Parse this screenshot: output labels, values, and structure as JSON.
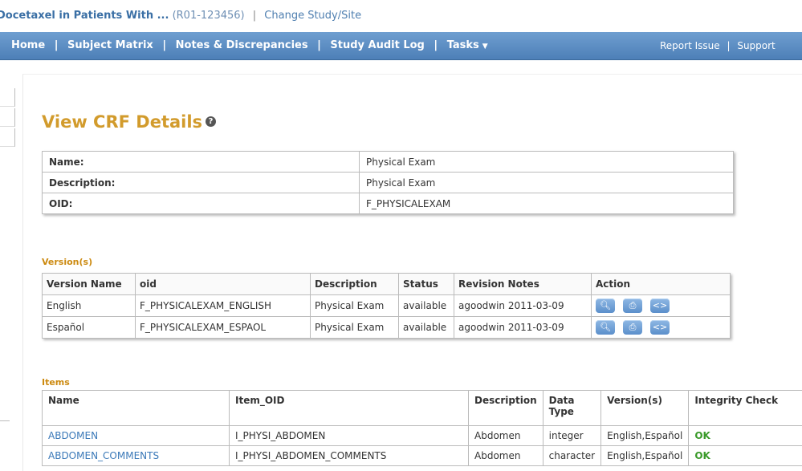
{
  "study": {
    "name": "Docetaxel in Patients With ...",
    "id": "(R01-123456)",
    "separator": "|",
    "change_link": "Change Study/Site"
  },
  "nav": {
    "items": [
      "Home",
      "Subject Matrix",
      "Notes & Discrepancies",
      "Study Audit Log",
      "Tasks"
    ],
    "separator": "|",
    "right": [
      "Report Issue",
      "Support"
    ]
  },
  "page": {
    "title": "View CRF Details"
  },
  "crf": {
    "rows": [
      {
        "label": "Name:",
        "value": "Physical Exam"
      },
      {
        "label": "Description:",
        "value": "Physical Exam"
      },
      {
        "label": "OID:",
        "value": "F_PHYSICALEXAM"
      }
    ]
  },
  "versions": {
    "section_label": "Version(s)",
    "headers": [
      "Version Name",
      "oid",
      "Description",
      "Status",
      "Revision Notes",
      "Action"
    ],
    "rows": [
      {
        "name": "English",
        "oid": "F_PHYSICALEXAM_ENGLISH",
        "description": "Physical Exam",
        "status": "available",
        "notes": "agoodwin 2011-03-09"
      },
      {
        "name": "Español",
        "oid": "F_PHYSICALEXAM_ESPAOL",
        "description": "Physical Exam",
        "status": "available",
        "notes": "agoodwin 2011-03-09"
      }
    ],
    "action_icons": [
      "view-icon",
      "print-icon",
      "code-icon"
    ]
  },
  "items": {
    "section_label": "Items",
    "headers": [
      "Name",
      "Item_OID",
      "Description",
      "Data Type",
      "Version(s)",
      "Integrity Check"
    ],
    "rows": [
      {
        "name": "ABDOMEN",
        "oid": "I_PHYSI_ABDOMEN",
        "description": "Abdomen",
        "type": "integer",
        "versions": "English,Español",
        "check": "OK"
      },
      {
        "name": "ABDOMEN_COMMENTS",
        "oid": "I_PHYSI_ABDOMEN_COMMENTS",
        "description": "Abdomen",
        "type": "character",
        "versions": "English,Español",
        "check": "OK"
      }
    ]
  },
  "colors": {
    "title": "#d29b2c",
    "section": "#cc8a10",
    "nav": "#5a8cc3",
    "link": "#3b79b8",
    "ok": "#3a9a2a"
  }
}
